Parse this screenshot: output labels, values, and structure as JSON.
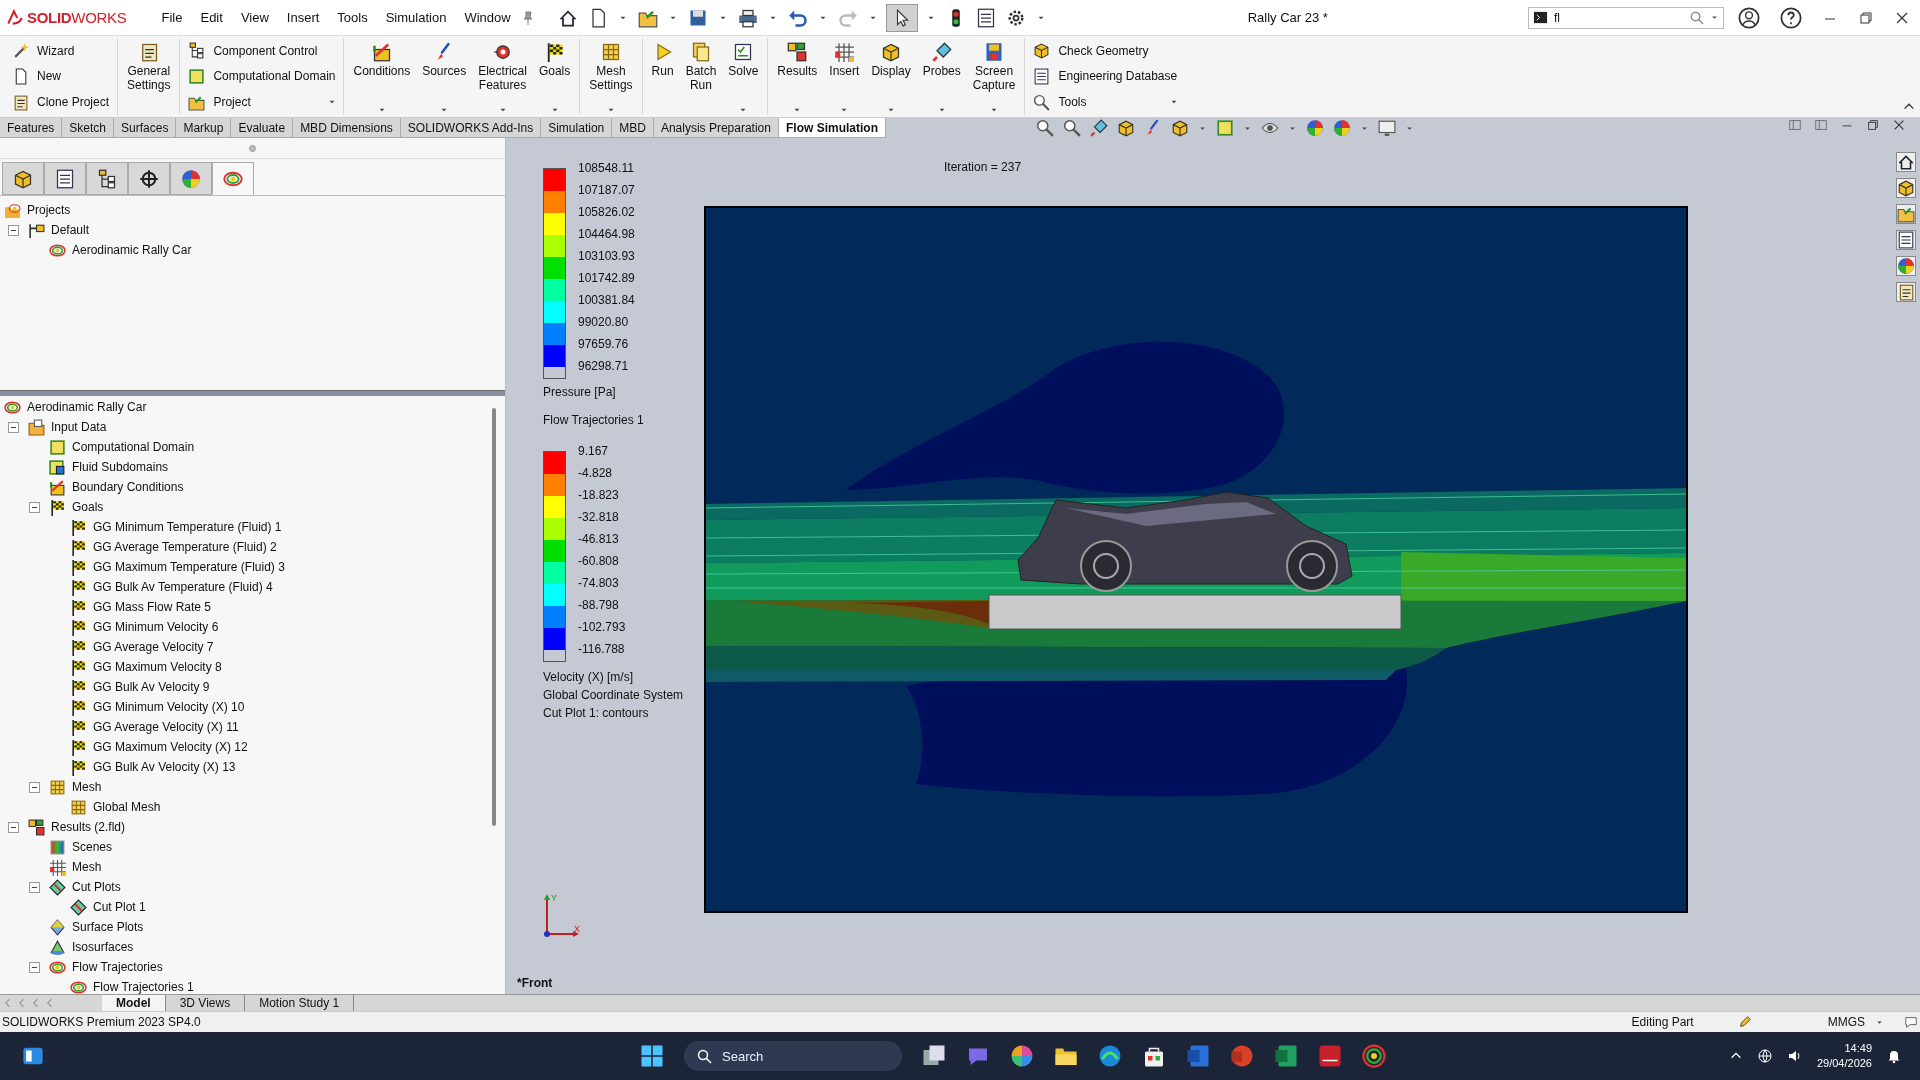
{
  "app": {
    "logo": "**SOLID**WORKS"
  },
  "menu": [
    "File",
    "Edit",
    "View",
    "Insert",
    "Tools",
    "Simulation",
    "Window"
  ],
  "window": {
    "title": "Rally Car 23 *"
  },
  "command_search": {
    "value": "fl"
  },
  "ribbon": {
    "groups": [
      {
        "kind": "small",
        "items": [
          {
            "label": "Wizard",
            "dropdown": false
          },
          {
            "label": "New",
            "dropdown": false
          },
          {
            "label": "Clone Project",
            "dropdown": false
          }
        ]
      },
      {
        "kind": "large",
        "items": [
          {
            "label": "General Settings",
            "dropdown": false
          }
        ]
      },
      {
        "kind": "small",
        "items": [
          {
            "label": "Component Control",
            "dropdown": false
          },
          {
            "label": "Computational Domain",
            "dropdown": false
          },
          {
            "label": "Project",
            "dropdown": true
          }
        ]
      },
      {
        "kind": "large",
        "items": [
          {
            "label": "Conditions",
            "dropdown": true
          },
          {
            "label": "Sources",
            "dropdown": true
          },
          {
            "label": "Electrical Features",
            "dropdown": true
          },
          {
            "label": "Goals",
            "dropdown": true
          }
        ]
      },
      {
        "kind": "large",
        "items": [
          {
            "label": "Mesh Settings",
            "dropdown": true
          }
        ]
      },
      {
        "kind": "large",
        "items": [
          {
            "label": "Run",
            "dropdown": false
          },
          {
            "label": "Batch Run",
            "dropdown": false
          },
          {
            "label": "Solve",
            "dropdown": true
          }
        ]
      },
      {
        "kind": "large",
        "items": [
          {
            "label": "Results",
            "dropdown": true
          },
          {
            "label": "Insert",
            "dropdown": true
          },
          {
            "label": "Display",
            "dropdown": true
          },
          {
            "label": "Probes",
            "dropdown": true
          },
          {
            "label": "Screen Capture",
            "dropdown": true
          }
        ]
      },
      {
        "kind": "small",
        "items": [
          {
            "label": "Check Geometry",
            "dropdown": false
          },
          {
            "label": "Engineering Database",
            "dropdown": false
          },
          {
            "label": "Tools",
            "dropdown": true
          }
        ]
      }
    ]
  },
  "command_tabs": [
    {
      "label": "Features",
      "selected": false
    },
    {
      "label": "Sketch",
      "selected": false
    },
    {
      "label": "Surfaces",
      "selected": false
    },
    {
      "label": "Markup",
      "selected": false
    },
    {
      "label": "Evaluate",
      "selected": false
    },
    {
      "label": "MBD Dimensions",
      "selected": false
    },
    {
      "label": "SOLIDWORKS Add-Ins",
      "selected": false
    },
    {
      "label": "Simulation",
      "selected": false
    },
    {
      "label": "MBD",
      "selected": false
    },
    {
      "label": "Analysis Preparation",
      "selected": false
    },
    {
      "label": "Flow Simulation",
      "selected": true
    }
  ],
  "panel_tabs": [
    {
      "selected": false
    },
    {
      "selected": false
    },
    {
      "selected": false
    },
    {
      "selected": false
    },
    {
      "selected": false
    },
    {
      "selected": true
    }
  ],
  "project_tree": [
    {
      "label": "Projects",
      "kind": "projects",
      "children": [
        {
          "label": "Default",
          "kind": "config",
          "expanded": true,
          "children": [
            {
              "label": "Aerodinamic Rally Car",
              "kind": "rings"
            }
          ]
        }
      ]
    }
  ],
  "feature_tree": [
    {
      "label": "Aerodinamic Rally Car",
      "kind": "rings",
      "children": [
        {
          "label": "Input Data",
          "kind": "folder",
          "expanded": true,
          "children": [
            {
              "label": "Computational Domain",
              "kind": "cube"
            },
            {
              "label": "Fluid Subdomains",
              "kind": "subdomain"
            },
            {
              "label": "Boundary Conditions",
              "kind": "boundary"
            },
            {
              "label": "Goals",
              "kind": "flag",
              "expanded": true,
              "children": [
                {
                  "label": "GG Minimum Temperature (Fluid) 1",
                  "kind": "flag"
                },
                {
                  "label": "GG Average Temperature (Fluid) 2",
                  "kind": "flag"
                },
                {
                  "label": "GG Maximum Temperature (Fluid) 3",
                  "kind": "flag"
                },
                {
                  "label": "GG Bulk Av Temperature (Fluid) 4",
                  "kind": "flag"
                },
                {
                  "label": "GG Mass Flow Rate 5",
                  "kind": "flag"
                },
                {
                  "label": "GG Minimum Velocity 6",
                  "kind": "flag"
                },
                {
                  "label": "GG Average Velocity 7",
                  "kind": "flag"
                },
                {
                  "label": "GG Maximum Velocity 8",
                  "kind": "flag"
                },
                {
                  "label": "GG Bulk Av Velocity 9",
                  "kind": "flag"
                },
                {
                  "label": "GG Minimum Velocity (X) 10",
                  "kind": "flag"
                },
                {
                  "label": "GG Average Velocity (X) 11",
                  "kind": "flag"
                },
                {
                  "label": "GG Maximum Velocity (X) 12",
                  "kind": "flag"
                },
                {
                  "label": "GG Bulk Av Velocity (X) 13",
                  "kind": "flag"
                }
              ]
            },
            {
              "label": "Mesh",
              "kind": "mesh",
              "expanded": true,
              "children": [
                {
                  "label": "Global Mesh",
                  "kind": "mesh"
                }
              ]
            }
          ]
        },
        {
          "label": "Results (2.fld)",
          "kind": "results",
          "expanded": true,
          "children": [
            {
              "label": "Scenes",
              "kind": "scenes"
            },
            {
              "label": "Mesh",
              "kind": "meshgrid"
            },
            {
              "label": "Cut Plots",
              "kind": "cutplot",
              "expanded": true,
              "children": [
                {
                  "label": "Cut Plot 1",
                  "kind": "cutplot"
                }
              ]
            },
            {
              "label": "Surface Plots",
              "kind": "surface"
            },
            {
              "label": "Isosurfaces",
              "kind": "iso"
            },
            {
              "label": "Flow Trajectories",
              "kind": "rings",
              "expanded": true,
              "children": [
                {
                  "label": "Flow Trajectories 1",
                  "kind": "rings"
                }
              ]
            }
          ]
        }
      ]
    }
  ],
  "bottom_tabs": [
    {
      "label": "Model",
      "selected": true
    },
    {
      "label": "3D Views",
      "selected": false
    },
    {
      "label": "Motion Study 1",
      "selected": false
    }
  ],
  "viewport": {
    "iteration": "Iteration = 237",
    "view_name": "*Front",
    "axis_y": "Y",
    "axis_x": "X",
    "legends": [
      {
        "labels": [
          "108548.11",
          "107187.07",
          "105826.02",
          "104464.98",
          "103103.93",
          "101742.89",
          "100381.84",
          "99020.80",
          "97659.76",
          "96298.71"
        ],
        "bands": [
          {
            "color": "#ff0000"
          },
          {
            "color": "#ff8000"
          },
          {
            "color": "#ffff00"
          },
          {
            "color": "#aaff00"
          },
          {
            "color": "#00e000"
          },
          {
            "color": "#00ffa0"
          },
          {
            "color": "#00ffff"
          },
          {
            "color": "#0080ff"
          },
          {
            "color": "#0000ff"
          }
        ],
        "captions": [
          "Pressure [Pa]",
          "Flow Trajectories 1"
        ]
      },
      {
        "labels": [
          "9.167",
          "-4.828",
          "-18.823",
          "-32.818",
          "-46.813",
          "-60.808",
          "-74.803",
          "-88.798",
          "-102.793",
          "-116.788"
        ],
        "bands": [
          {
            "color": "#ff0000"
          },
          {
            "color": "#ff8000"
          },
          {
            "color": "#ffff00"
          },
          {
            "color": "#aaff00"
          },
          {
            "color": "#00e000"
          },
          {
            "color": "#00ffa0"
          },
          {
            "color": "#00ffff"
          },
          {
            "color": "#0080ff"
          },
          {
            "color": "#0000ff"
          }
        ],
        "captions": [
          "Velocity (X) [m/s]",
          "Global Coordinate System",
          "Cut Plot 1: contours"
        ]
      }
    ]
  },
  "status_bar": {
    "product": "SOLIDWORKS Premium 2023 SP4.0",
    "mode": "Editing Part",
    "units": "MMGS"
  },
  "taskbar": {
    "search_placeholder": "Search",
    "time": "14:49",
    "date": "29/04/2026"
  }
}
